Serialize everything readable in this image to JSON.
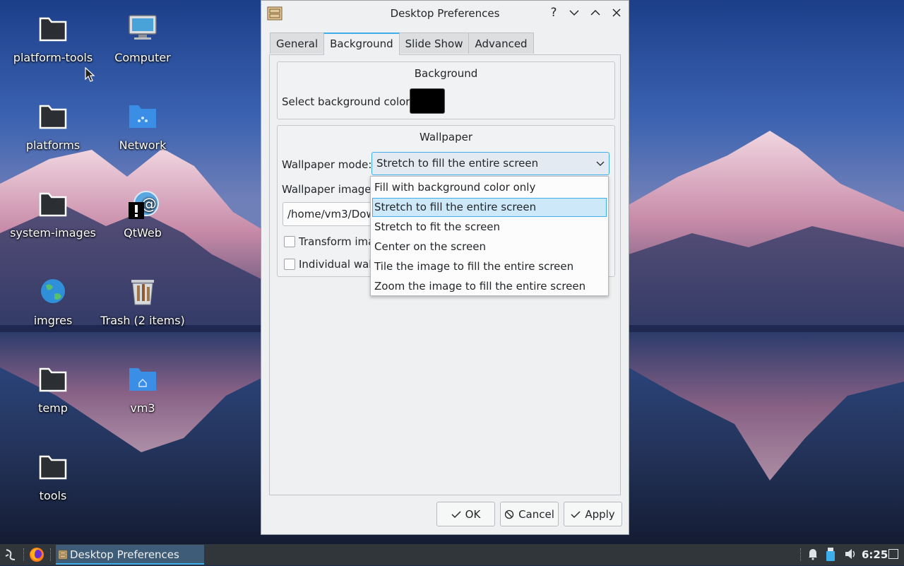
{
  "desktop": {
    "icons": [
      {
        "label": "platform-tools",
        "icon": "folder-icon"
      },
      {
        "label": "Computer",
        "icon": "computer-icon"
      },
      {
        "label": "platforms",
        "icon": "folder-icon"
      },
      {
        "label": "Network",
        "icon": "network-folder-icon"
      },
      {
        "label": "system-images",
        "icon": "folder-icon"
      },
      {
        "label": "QtWeb",
        "icon": "qtweb-icon"
      },
      {
        "label": "imgres",
        "icon": "globe-icon"
      },
      {
        "label": "Trash (2 items)",
        "icon": "trash-icon"
      },
      {
        "label": "temp",
        "icon": "folder-icon"
      },
      {
        "label": "vm3",
        "icon": "home-folder-icon"
      },
      {
        "label": "tools",
        "icon": "folder-icon"
      }
    ]
  },
  "dialog": {
    "title": "Desktop Preferences",
    "title_buttons": [
      "?",
      "minimize",
      "maximize",
      "close"
    ],
    "tabs": [
      {
        "label": "General",
        "active": false
      },
      {
        "label": "Background",
        "active": true
      },
      {
        "label": "Slide Show",
        "active": false
      },
      {
        "label": "Advanced",
        "active": false
      }
    ],
    "background_group": {
      "title": "Background",
      "color_label": "Select background color:",
      "color_value": "#000000"
    },
    "wallpaper_group": {
      "title": "Wallpaper",
      "mode_label": "Wallpaper mode:",
      "mode_value": "Stretch to fill the entire screen",
      "image_label": "Wallpaper image f",
      "image_path": "/home/vm3/Dow",
      "transform_label": "Transform ima",
      "individual_label": "Individual wall"
    },
    "dropdown_options": [
      "Fill with background color only",
      "Stretch to fill the entire screen",
      "Stretch to fit the screen",
      "Center on the screen",
      "Tile the image to fill the entire screen",
      "Zoom the image to fill the entire screen"
    ],
    "selected_option_index": 1,
    "buttons": {
      "ok": "OK",
      "cancel": "Cancel",
      "apply": "Apply"
    }
  },
  "taskbar": {
    "task_label": "Desktop Preferences",
    "clock": "6:25"
  },
  "colors": {
    "accent": "#3daee9",
    "taskbar": "#31363b",
    "dialog_bg": "#eff0f1"
  }
}
